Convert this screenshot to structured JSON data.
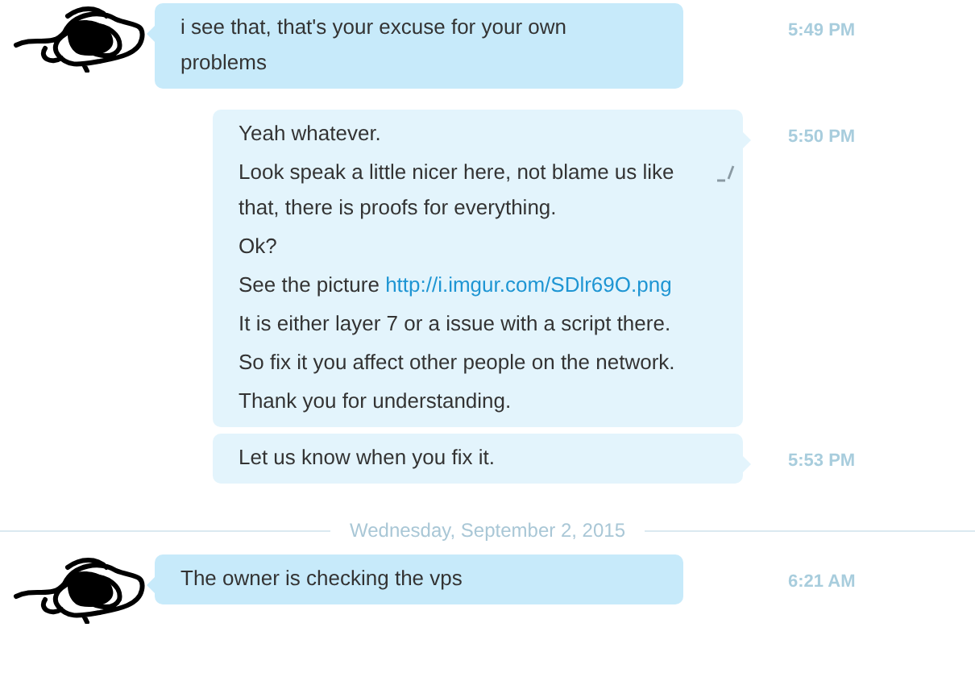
{
  "messages": [
    {
      "kind": "incoming",
      "time": "5:49 PM",
      "paragraphs": [
        {
          "text": "i see that, that's your excuse for your own problems"
        }
      ]
    },
    {
      "kind": "outgoing",
      "time": "5:50 PM",
      "paragraphs": [
        {
          "text": "Yeah whatever."
        },
        {
          "text": "Look speak a little nicer here, not blame us like that, there is proofs for everything.",
          "edited": true
        },
        {
          "text": "Ok?"
        },
        {
          "text": "See the picture ",
          "link": "http://i.imgur.com/SDlr69O.png"
        },
        {
          "text": "It is either layer 7 or a issue with a script there."
        },
        {
          "text": "So fix it you affect other people on the network."
        },
        {
          "text": "Thank you for understanding."
        }
      ]
    },
    {
      "kind": "outgoing",
      "time": "5:53 PM",
      "paragraphs": [
        {
          "text": "Let us know when you fix it."
        }
      ]
    },
    {
      "kind": "date",
      "text": "Wednesday, September 2, 2015"
    },
    {
      "kind": "incoming",
      "time": "6:21 AM",
      "paragraphs": [
        {
          "text": "The owner is checking the vps"
        }
      ]
    }
  ]
}
